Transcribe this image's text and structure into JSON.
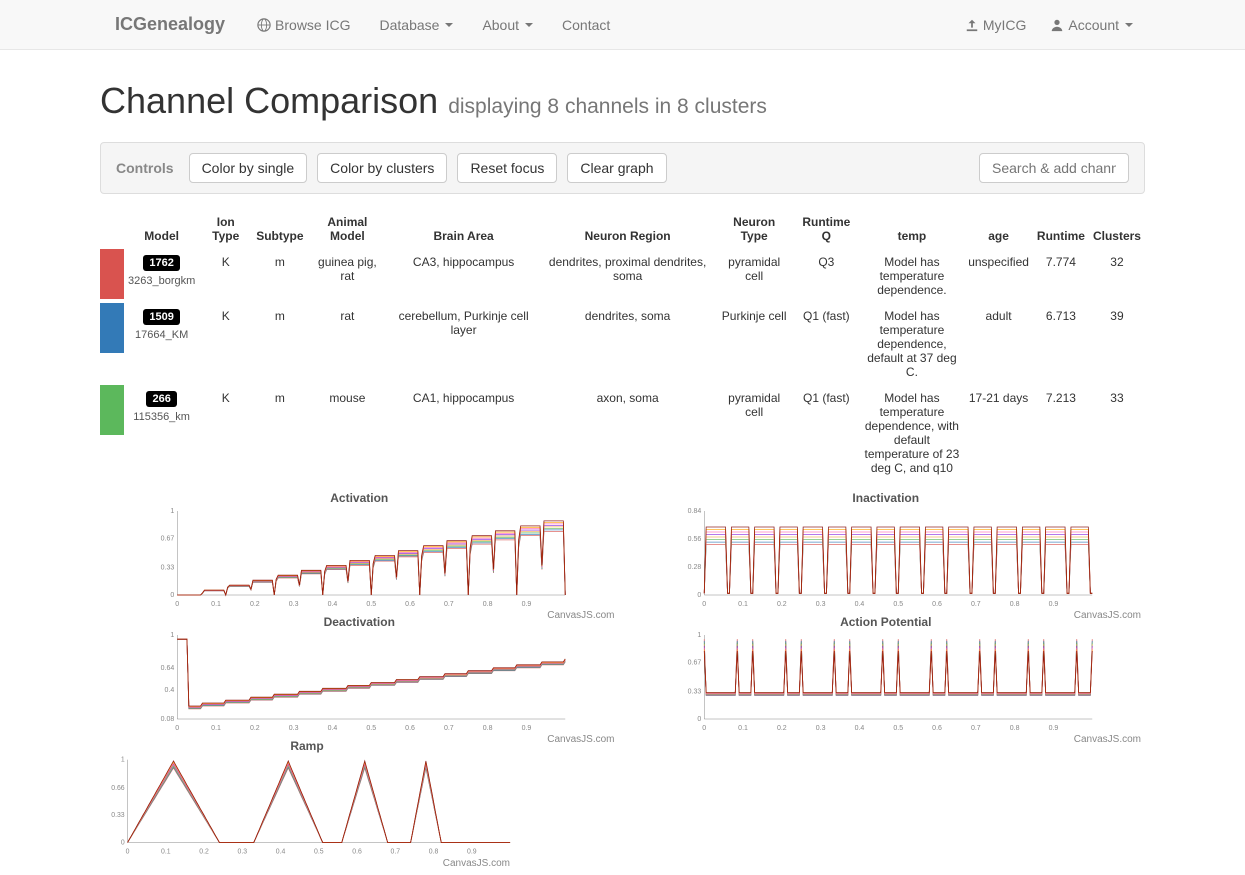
{
  "nav": {
    "brand": "ICGenealogy",
    "browse": "Browse ICG",
    "database": "Database",
    "about": "About",
    "contact": "Contact",
    "myicg": "MyICG",
    "account": "Account"
  },
  "page": {
    "title": "Channel Comparison",
    "subtitle": "displaying 8 channels in 8 clusters"
  },
  "controls": {
    "label": "Controls",
    "color_single": "Color by single",
    "color_clusters": "Color by clusters",
    "reset_focus": "Reset focus",
    "clear_graph": "Clear graph",
    "search_placeholder": "Search & add channels"
  },
  "table": {
    "headers": {
      "model": "Model",
      "ion_type": "Ion Type",
      "subtype": "Subtype",
      "animal_model": "Animal Model",
      "brain_area": "Brain Area",
      "neuron_region": "Neuron Region",
      "neuron_type": "Neuron Type",
      "runtime_q": "Runtime Q",
      "temp": "temp",
      "age": "age",
      "runtime": "Runtime",
      "clusters": "Clusters"
    },
    "rows": [
      {
        "color": "#d9534f",
        "badge": "1762",
        "model": "3263_borgkm",
        "ion_type": "K",
        "subtype": "m",
        "animal_model": "guinea pig, rat",
        "brain_area": "CA3, hippocampus",
        "neuron_region": "dendrites, proximal dendrites, soma",
        "neuron_type": "pyramidal cell",
        "runtime_q": "Q3",
        "temp": "Model has temperature dependence.",
        "age": "unspecified",
        "runtime": "7.774",
        "clusters": "32"
      },
      {
        "color": "#337ab7",
        "badge": "1509",
        "model": "17664_KM",
        "ion_type": "K",
        "subtype": "m",
        "animal_model": "rat",
        "brain_area": "cerebellum, Purkinje cell layer",
        "neuron_region": "dendrites, soma",
        "neuron_type": "Purkinje cell",
        "runtime_q": "Q1 (fast)",
        "temp": "Model has temperature dependence, default at 37 deg C.",
        "age": "adult",
        "runtime": "6.713",
        "clusters": "39"
      },
      {
        "color": "#5cb85c",
        "badge": "266",
        "model": "115356_km",
        "ion_type": "K",
        "subtype": "m",
        "animal_model": "mouse",
        "brain_area": "CA1, hippocampus",
        "neuron_region": "axon, soma",
        "neuron_type": "pyramidal cell",
        "runtime_q": "Q1 (fast)",
        "temp": "Model has temperature dependence, with default temperature of 23 deg C, and q10",
        "age": "17-21 days",
        "runtime": "7.213",
        "clusters": "33"
      }
    ]
  },
  "chart_data": [
    {
      "type": "line",
      "title": "Activation",
      "xlim": [
        0,
        1
      ],
      "ylim": [
        0,
        1
      ],
      "xticks": [
        0,
        0.1,
        0.2,
        0.3,
        0.4,
        0.5,
        0.6,
        0.7,
        0.8,
        0.9
      ],
      "yticks": [
        0,
        0.33,
        0.67,
        1
      ],
      "credit": "CanvasJS.com",
      "series_colors": [
        "#d9534f",
        "#337ab7",
        "#5cb85c",
        "#f0ad4e",
        "#8a2be2",
        "#ff69b4",
        "#ffa500",
        "#800000"
      ],
      "description": "Multiple overlapping step-rise curves, 16 steps increasing in amplitude from ~0 to ~1 across x-axis"
    },
    {
      "type": "line",
      "title": "Inactivation",
      "xlim": [
        0,
        1
      ],
      "ylim": [
        0,
        0.84
      ],
      "xticks": [
        0,
        0.1,
        0.2,
        0.3,
        0.4,
        0.5,
        0.6,
        0.7,
        0.8,
        0.9
      ],
      "yticks": [
        0,
        0.28,
        0.56,
        0.84
      ],
      "credit": "CanvasJS.com",
      "series_colors": [
        "#d9534f",
        "#337ab7",
        "#5cb85c",
        "#f0ad4e",
        "#8a2be2",
        "#ff69b4",
        "#ffa500",
        "#800000"
      ],
      "description": "Repeated plateau pulses at ~0.6-0.8 height across x-axis, 16 pulses"
    },
    {
      "type": "line",
      "title": "Deactivation",
      "xlim": [
        0,
        1
      ],
      "ylim": [
        0.08,
        1
      ],
      "xticks": [
        0,
        0.1,
        0.2,
        0.3,
        0.4,
        0.5,
        0.6,
        0.7,
        0.8,
        0.9
      ],
      "yticks": [
        0.08,
        0.4,
        0.64,
        1
      ],
      "credit": "CanvasJS.com",
      "series_colors": [
        "#d9534f",
        "#337ab7",
        "#5cb85c",
        "#f0ad4e",
        "#8a2be2",
        "#ff69b4",
        "#ffa500",
        "#800000"
      ],
      "description": "Initial spike to 1 then staircase rising from ~0.1 to ~0.7 across x-axis"
    },
    {
      "type": "line",
      "title": "Action Potential",
      "xlim": [
        0,
        1
      ],
      "ylim": [
        0,
        1
      ],
      "xticks": [
        0,
        0.1,
        0.2,
        0.3,
        0.4,
        0.5,
        0.6,
        0.7,
        0.8,
        0.9
      ],
      "yticks": [
        0,
        0.33,
        0.67,
        1
      ],
      "credit": "CanvasJS.com",
      "series_colors": [
        "#d9534f",
        "#337ab7",
        "#5cb85c",
        "#f0ad4e",
        "#8a2be2",
        "#ff69b4",
        "#ffa500",
        "#800000"
      ],
      "description": "Many narrow spike trains, baseline ~0.3 with spikes to ~1.0, ~24 spikes"
    },
    {
      "type": "line",
      "title": "Ramp",
      "xlim": [
        0,
        1
      ],
      "ylim": [
        0,
        1
      ],
      "xticks": [
        0,
        0.1,
        0.2,
        0.3,
        0.4,
        0.5,
        0.6,
        0.7,
        0.8,
        0.9
      ],
      "yticks": [
        0,
        0.33,
        0.66,
        1
      ],
      "credit": "CanvasJS.com",
      "series_colors": [
        "#d9534f",
        "#337ab7",
        "#5cb85c",
        "#f0ad4e",
        "#8a2be2",
        "#ff69b4",
        "#ffa500",
        "#800000"
      ],
      "description": "Four triangular ramp pulses of decreasing width, peaks at 1.0 located around x=0.12, 0.42, 0.62, 0.78"
    }
  ]
}
